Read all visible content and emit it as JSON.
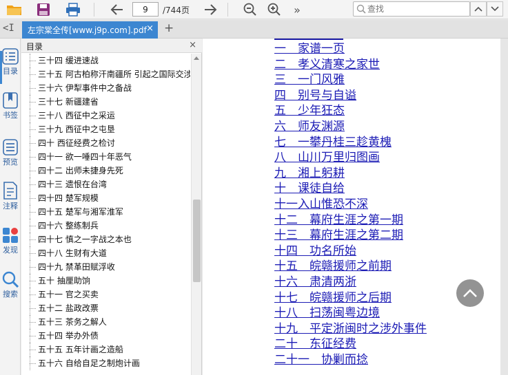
{
  "toolbar": {
    "page_current": "9",
    "page_total": "/744页",
    "search_placeholder": "查找",
    "more_glyph": "»"
  },
  "tab": {
    "title": "左宗棠全传[www.j9p.com].pdf",
    "close_glyph": "×",
    "add_glyph": "+",
    "collapse_glyph": "<I"
  },
  "rail": {
    "items": [
      {
        "label": "目录",
        "icon": "list-icon"
      },
      {
        "label": "书签",
        "icon": "bookmark-icon"
      },
      {
        "label": "预览",
        "icon": "preview-icon"
      },
      {
        "label": "注释",
        "icon": "annotation-icon"
      },
      {
        "label": "发现",
        "icon": "discover-icon"
      },
      {
        "label": "搜索",
        "icon": "search-icon"
      }
    ]
  },
  "toc": {
    "title": "目录",
    "close_glyph": "×",
    "items": [
      "三十四 缓进速战",
      "三十五 阿古柏称汗南疆所 引起之国际交涉",
      "三十六 伊犁事件中之备战",
      "三十七 新疆建省",
      "三十八 西征中之采运",
      "三十九 西征中之屯垦",
      "四十 西征经费之检讨",
      "四十一 欲一唾四十年恶气",
      "四十二 出师未捷身先死",
      "四十三 遗恨在台湾",
      "四十四 楚军规模",
      "四十五 楚军与湘军淮军",
      "四十六 整练制兵",
      "四十七 慎之一字战之本也",
      "四十八 生财有大道",
      "四十九 禁革田赋浮收",
      "五十 抽厘助饷",
      "五十一 官之买卖",
      "五十二 盐政改票",
      "五十三 茶务之解人",
      "五十四 举办外债",
      "五十五 五年计画之造船",
      "五十六 自给自足之制炮计画"
    ]
  },
  "document": {
    "chapters": [
      "一　家谱一页",
      "二　孝义清寒之家世",
      "三　一门风雅",
      "四　别号与自谥",
      "五　少年狂态",
      "六　师友渊源",
      "七　一攀丹桂三趁黄槐",
      "八　山川万里归图画",
      "九　湘上躬耕",
      "十　课徒自给",
      "十一入山惟恐不深",
      "十二　幕府生涯之第一期",
      "十三　幕府生涯之第二期",
      "十四　功名所始",
      "十五　皖赣援师之前期",
      "十六　肃清两浙",
      "十七　皖赣援师之后期",
      "十八　扫荡闽粤边境",
      "十九　平定浙闽时之涉外事件",
      "二十　东征经费",
      "二十一　协剿而捻"
    ]
  },
  "colors": {
    "accent": "#3c86d1",
    "link": "#1c1cb5",
    "open_icon": "#f0a21a",
    "save_icon": "#8a2e7c",
    "discover_red": "#e94040"
  }
}
